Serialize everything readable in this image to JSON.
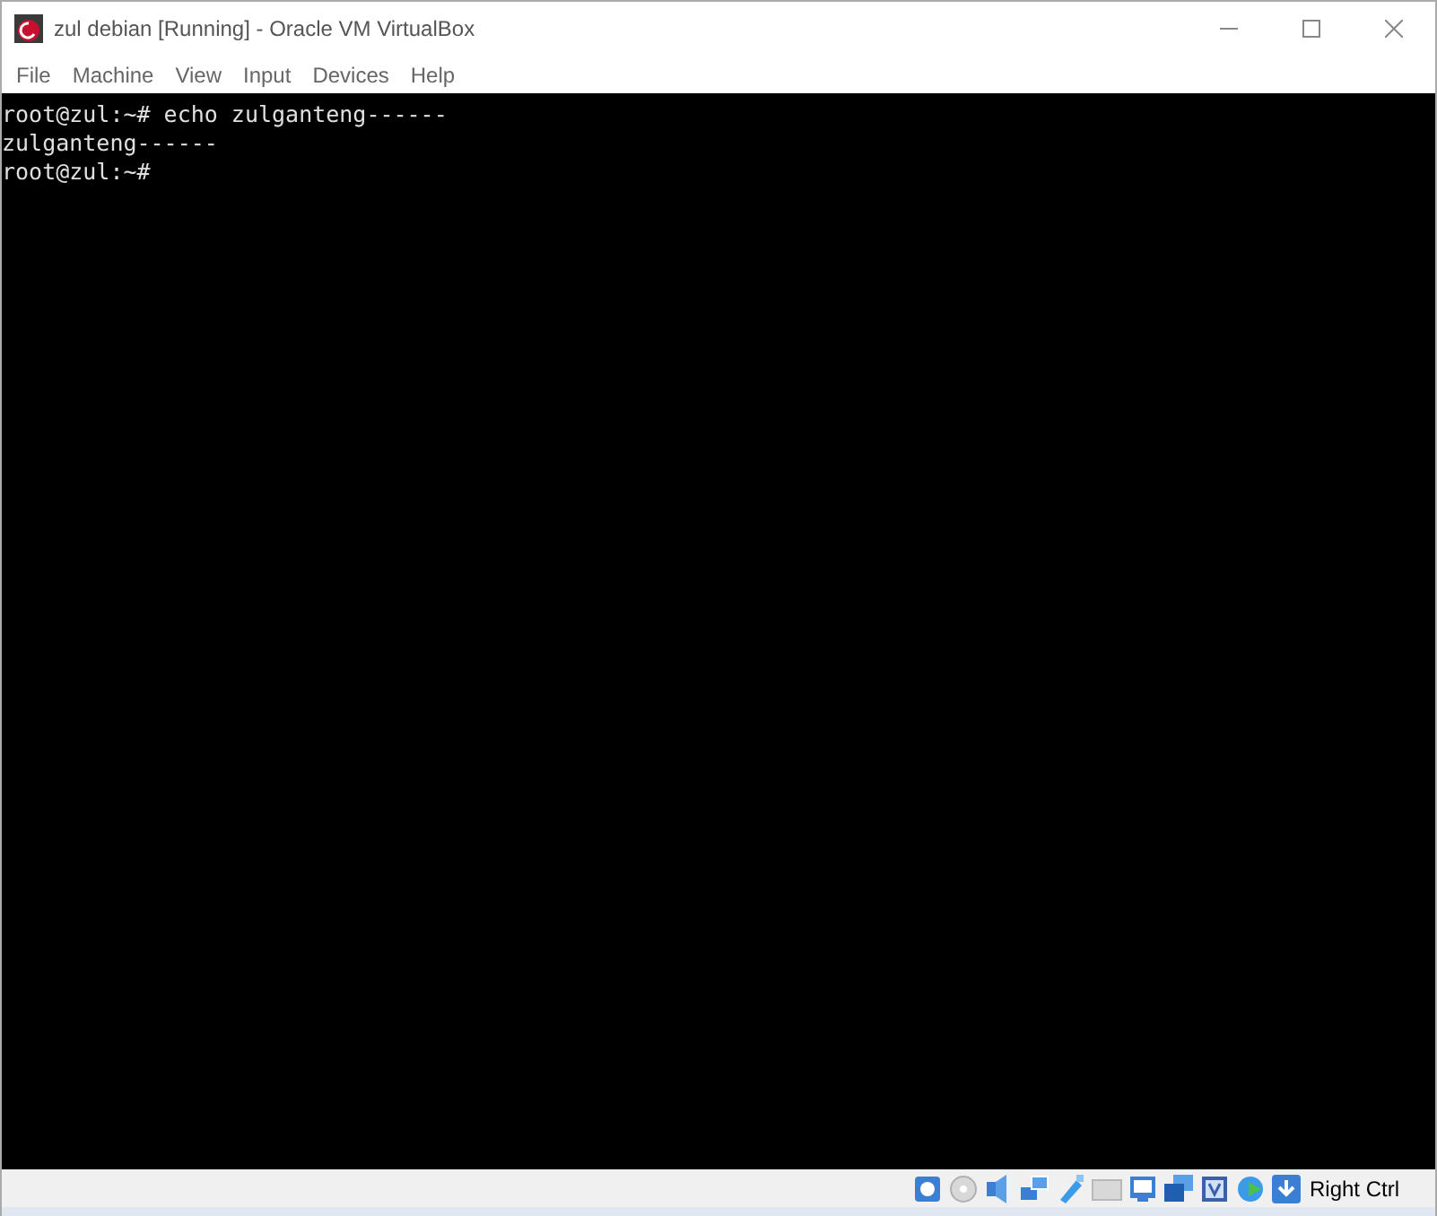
{
  "window": {
    "title": "zul debian [Running] - Oracle VM VirtualBox"
  },
  "menu": [
    "File",
    "Machine",
    "View",
    "Input",
    "Devices",
    "Help"
  ],
  "console": {
    "lines": [
      "root@zul:~# echo zulganteng------",
      "zulganteng------",
      "root@zul:~#"
    ]
  },
  "status_bar": {
    "host_key": "Right Ctrl"
  }
}
